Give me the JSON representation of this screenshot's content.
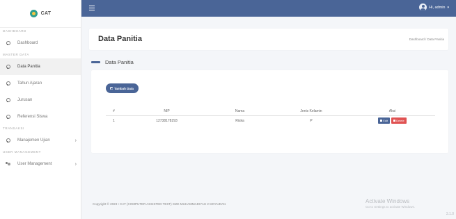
{
  "brand": {
    "name": "CAT"
  },
  "sidebar": {
    "sections": [
      {
        "label": "DASHBOARD"
      },
      {
        "label": "MASTER DATA"
      },
      {
        "label": "TRANSAKSI"
      },
      {
        "label": "USER MANAGEMENT"
      }
    ],
    "items": [
      {
        "label": "Dashboard",
        "icon": "gear-icon"
      },
      {
        "label": "Data Panitia",
        "icon": "gear-icon",
        "active": true
      },
      {
        "label": "Tahun Ajaran",
        "icon": "gear-icon"
      },
      {
        "label": "Jurusan",
        "icon": "gear-icon"
      },
      {
        "label": "Referensi Siswa",
        "icon": "gear-icon"
      },
      {
        "label": "Manajemen Ujian",
        "icon": "gear-icon",
        "chevron": "›"
      },
      {
        "label": "User Management",
        "icon": "users-icon",
        "chevron": "›"
      }
    ]
  },
  "topbar": {
    "user_label": "Hi, admin",
    "caret": "▾"
  },
  "header": {
    "title": "Data Panitia",
    "breadcrumb": "Dashboard / Data Panitia"
  },
  "content": {
    "subtitle": "Data Panitia",
    "add_button": "Tambah Data",
    "table": {
      "headers": [
        "#",
        "NIP",
        "Nama",
        "Jenis Kelamin",
        "Aksi"
      ],
      "rows": [
        {
          "no": "1",
          "nip": "12738178293",
          "nama": "Riska",
          "jk": "P",
          "edit": "Edit",
          "delete": "Delete"
        }
      ]
    }
  },
  "footer": {
    "copyright": "Copyright © 2023 • CAT (COMPUTER ASSISTED TEST) SMK MUHAMMADIYAH 2 MOYUDAN"
  },
  "watermark": {
    "title": "Activate Windows",
    "subtitle": "Go to Settings to activate Windows."
  },
  "version": "3.1.0",
  "colors": {
    "primary": "#4a6597",
    "danger": "#e05252",
    "background": "#f4f6f9"
  }
}
